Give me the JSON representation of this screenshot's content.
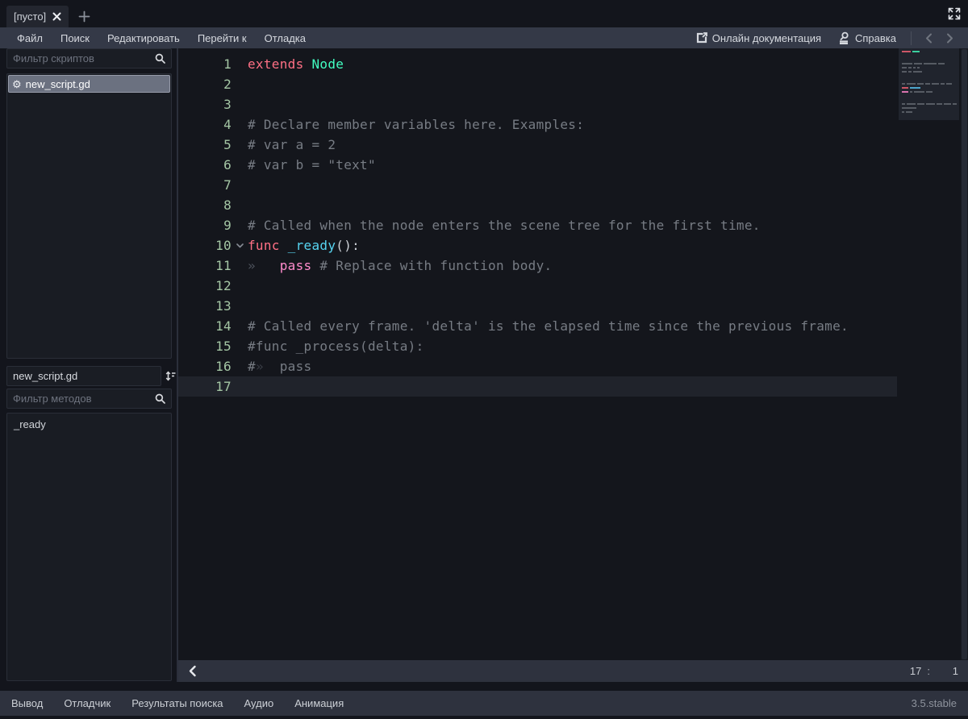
{
  "tabbar": {
    "tab_label": "[пусто]"
  },
  "menubar": {
    "items": [
      "Файл",
      "Поиск",
      "Редактировать",
      "Перейти к",
      "Отладка"
    ],
    "online_docs_label": "Онлайн документация",
    "help_label": "Справка"
  },
  "sidebar": {
    "scripts_filter_placeholder": "Фильтр скриптов",
    "selected_script": "new_script.gd",
    "script_name_value": "new_script.gd",
    "methods_filter_placeholder": "Фильтр методов",
    "method": "_ready"
  },
  "editor": {
    "current_line": 17,
    "status": {
      "line": "17",
      "colon": ":",
      "column": "1"
    },
    "lines": [
      {
        "num": "1",
        "segs": [
          {
            "t": "kw",
            "s": "extends"
          },
          {
            "t": "tx",
            "s": " "
          },
          {
            "t": "ty",
            "s": "Node"
          }
        ]
      },
      {
        "num": "2",
        "segs": []
      },
      {
        "num": "3",
        "segs": []
      },
      {
        "num": "4",
        "segs": [
          {
            "t": "cm",
            "s": "# Declare member variables here. Examples:"
          }
        ]
      },
      {
        "num": "5",
        "segs": [
          {
            "t": "cm",
            "s": "# var a = 2"
          }
        ]
      },
      {
        "num": "6",
        "segs": [
          {
            "t": "cm",
            "s": "# var b = \"text\""
          }
        ]
      },
      {
        "num": "7",
        "segs": []
      },
      {
        "num": "8",
        "segs": []
      },
      {
        "num": "9",
        "segs": [
          {
            "t": "cm",
            "s": "# Called when the node enters the scene tree for the first time."
          }
        ]
      },
      {
        "num": "10",
        "fold": true,
        "segs": [
          {
            "t": "kw",
            "s": "func"
          },
          {
            "t": "tx",
            "s": " "
          },
          {
            "t": "fn",
            "s": "_ready"
          },
          {
            "t": "tx",
            "s": "():"
          }
        ]
      },
      {
        "num": "11",
        "segs": [
          {
            "t": "tb",
            "s": "»"
          },
          {
            "t": "tx",
            "s": "   "
          },
          {
            "t": "ct",
            "s": "pass"
          },
          {
            "t": "cm",
            "s": " # Replace with function body."
          }
        ]
      },
      {
        "num": "12",
        "segs": []
      },
      {
        "num": "13",
        "segs": []
      },
      {
        "num": "14",
        "segs": [
          {
            "t": "cm",
            "s": "# Called every frame. 'delta' is the elapsed time since the previous frame."
          }
        ]
      },
      {
        "num": "15",
        "segs": [
          {
            "t": "cm",
            "s": "#func _process(delta):"
          }
        ]
      },
      {
        "num": "16",
        "segs": [
          {
            "t": "cm",
            "s": "#"
          },
          {
            "t": "tb2",
            "s": "»"
          },
          {
            "t": "cm",
            "s": "  pass"
          }
        ]
      },
      {
        "num": "17",
        "cur": true,
        "segs": []
      }
    ]
  },
  "minimap": {
    "lines": [
      {
        "y": 3,
        "segs": [
          {
            "w": 11,
            "c": "#cc5666"
          },
          {
            "w": 9,
            "c": "#3bcf9e"
          }
        ]
      },
      {
        "y": 18,
        "segs": [
          {
            "w": 13,
            "c": "#565b63"
          },
          {
            "w": 10,
            "c": "#565b63"
          },
          {
            "w": 16,
            "c": "#565b63"
          },
          {
            "w": 8,
            "c": "#565b63"
          }
        ]
      },
      {
        "y": 23,
        "segs": [
          {
            "w": 6,
            "c": "#565b63"
          },
          {
            "w": 4,
            "c": "#565b63"
          },
          {
            "w": 3,
            "c": "#565b63"
          },
          {
            "w": 3,
            "c": "#565b63"
          }
        ]
      },
      {
        "y": 28,
        "segs": [
          {
            "w": 6,
            "c": "#565b63"
          },
          {
            "w": 4,
            "c": "#565b63"
          },
          {
            "w": 11,
            "c": "#565b63"
          }
        ]
      },
      {
        "y": 43,
        "segs": [
          {
            "w": 4,
            "c": "#565b63"
          },
          {
            "w": 11,
            "c": "#565b63"
          },
          {
            "w": 8,
            "c": "#565b63"
          },
          {
            "w": 6,
            "c": "#565b63"
          },
          {
            "w": 9,
            "c": "#565b63"
          },
          {
            "w": 5,
            "c": "#565b63"
          },
          {
            "w": 7,
            "c": "#565b63"
          }
        ]
      },
      {
        "y": 48,
        "segs": [
          {
            "w": 8,
            "c": "#cc5666"
          },
          {
            "w": 13,
            "c": "#4da6cc"
          }
        ]
      },
      {
        "y": 53,
        "segs": [
          {
            "w": 8,
            "c": "#d973ae"
          },
          {
            "w": 3,
            "c": "#565b63"
          },
          {
            "w": 13,
            "c": "#565b63"
          },
          {
            "w": 8,
            "c": "#565b63"
          }
        ]
      },
      {
        "y": 68,
        "segs": [
          {
            "w": 4,
            "c": "#565b63"
          },
          {
            "w": 11,
            "c": "#565b63"
          },
          {
            "w": 9,
            "c": "#565b63"
          },
          {
            "w": 11,
            "c": "#565b63"
          },
          {
            "w": 7,
            "c": "#565b63"
          },
          {
            "w": 9,
            "c": "#565b63"
          },
          {
            "w": 5,
            "c": "#565b63"
          }
        ]
      },
      {
        "y": 73,
        "segs": [
          {
            "w": 18,
            "c": "#565b63"
          }
        ]
      },
      {
        "y": 78,
        "segs": [
          {
            "w": 3,
            "c": "#565b63"
          },
          {
            "w": 8,
            "c": "#565b63"
          }
        ]
      }
    ]
  },
  "bottom_bar": {
    "items": [
      "Вывод",
      "Отладчик",
      "Результаты поиска",
      "Аудио",
      "Анимация"
    ],
    "version": "3.5.stable"
  },
  "colors": {
    "keyword": "#ff7085",
    "base_type": "#42ffc2",
    "function": "#57d5f2",
    "control_flow": "#ff8ccc",
    "comment": "#777c84",
    "text": "#ccd0d6",
    "line_number": "#a5c7a5",
    "selection_bg": "#6b7180",
    "menubar_bg": "#343947",
    "editor_bg": "#14161c",
    "current_line_bg": "#20232b"
  }
}
